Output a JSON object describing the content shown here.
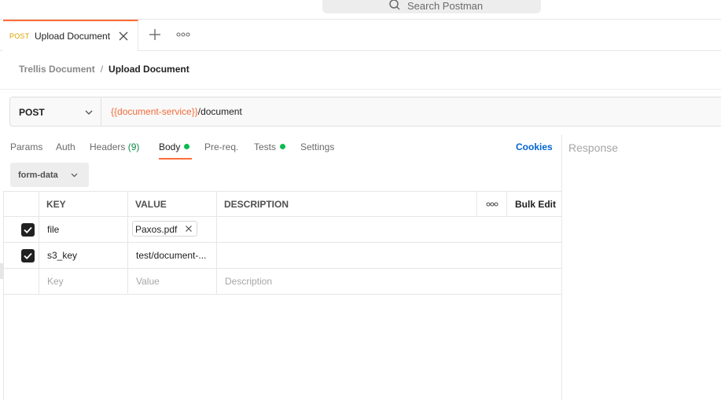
{
  "search": {
    "placeholder": "Search Postman"
  },
  "tab": {
    "method": "POST",
    "title": "Upload Document"
  },
  "breadcrumb": {
    "parent": "Trellis Document",
    "separator": "/",
    "current": "Upload Document"
  },
  "request": {
    "method": "POST",
    "url_variable": "{{document-service}}",
    "url_path": "/document"
  },
  "subtabs": {
    "params": "Params",
    "auth": "Auth",
    "headers": "Headers",
    "headers_count": "(9)",
    "body": "Body",
    "prereq": "Pre-req.",
    "tests": "Tests",
    "settings": "Settings",
    "cookies": "Cookies"
  },
  "response": {
    "label": "Response"
  },
  "body_type": {
    "selected": "form-data"
  },
  "table": {
    "headers": {
      "key": "KEY",
      "value": "VALUE",
      "description": "DESCRIPTION",
      "bulk_edit": "Bulk Edit"
    },
    "rows": [
      {
        "checked": true,
        "key": "file",
        "value": "Paxos.pdf",
        "value_type": "file",
        "description": ""
      },
      {
        "checked": true,
        "key": "s3_key",
        "value": "test/document-...",
        "value_type": "text",
        "description": ""
      }
    ],
    "placeholders": {
      "key": "Key",
      "value": "Value",
      "description": "Description"
    }
  },
  "colors": {
    "accent": "#ff6c37",
    "variable": "#f26b3a",
    "link": "#0265d2",
    "status_dot": "#0cbb52"
  }
}
